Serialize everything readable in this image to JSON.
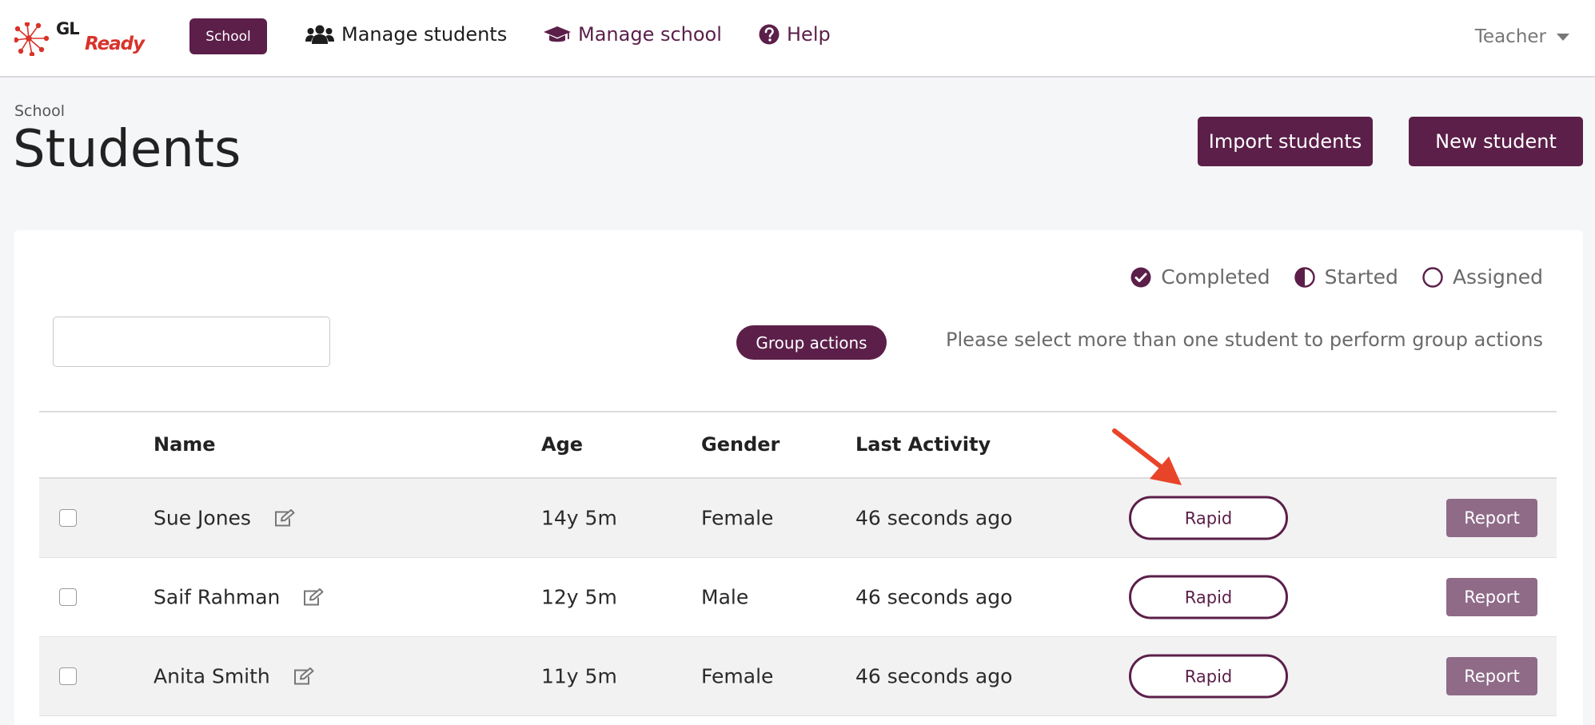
{
  "navbar": {
    "logo_gl": "GL",
    "logo_ready": "Ready",
    "school_badge": "School",
    "links": [
      {
        "label": "Manage students",
        "icon": "users-icon"
      },
      {
        "label": "Manage school",
        "icon": "graduation-cap-icon"
      },
      {
        "label": "Help",
        "icon": "question-circle-icon"
      }
    ],
    "user_menu": "Teacher"
  },
  "header": {
    "breadcrumb": "School",
    "title": "Students",
    "import_button": "Import students",
    "new_button": "New student"
  },
  "legend": {
    "completed": "Completed",
    "started": "Started",
    "assigned": "Assigned"
  },
  "search": {
    "value": "",
    "placeholder": ""
  },
  "group_actions": {
    "button": "Group actions",
    "hint": "Please select more than one student to perform group actions"
  },
  "table": {
    "columns": [
      "Name",
      "Age",
      "Gender",
      "Last Activity"
    ],
    "rows": [
      {
        "name": "Sue Jones",
        "age": "14y 5m",
        "gender": "Female",
        "last_activity": "46 seconds ago",
        "assessment": "Rapid",
        "report": "Report"
      },
      {
        "name": "Saif Rahman",
        "age": "12y 5m",
        "gender": "Male",
        "last_activity": "46 seconds ago",
        "assessment": "Rapid",
        "report": "Report"
      },
      {
        "name": "Anita Smith",
        "age": "11y 5m",
        "gender": "Female",
        "last_activity": "46 seconds ago",
        "assessment": "Rapid",
        "report": "Report"
      }
    ]
  },
  "colors": {
    "brand": "#5b1f49",
    "report": "#8f6b88",
    "annotation_arrow": "#e8442a"
  }
}
